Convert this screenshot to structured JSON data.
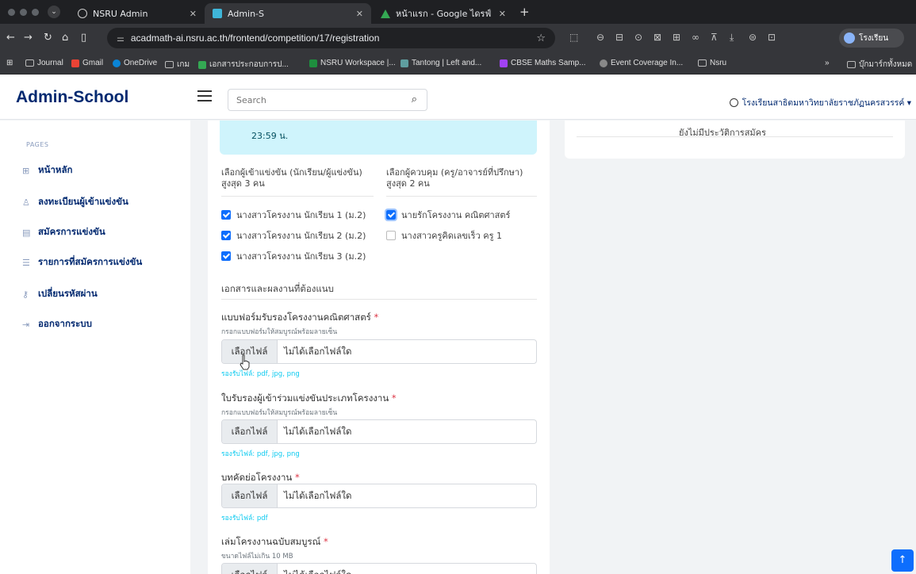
{
  "browser": {
    "tabs": [
      {
        "title": "NSRU Admin",
        "active": false
      },
      {
        "title": "Admin-S",
        "active": true
      },
      {
        "title": "หน้าแรก - Google ไดรฟ์",
        "active": false
      }
    ],
    "url": "acadmath-ai.nsru.ac.th/frontend/competition/17/registration",
    "profile_label": "โรงเรียน",
    "bookmarks": [
      "Journal",
      "Gmail",
      "OneDrive",
      "เกม",
      "เอกสารประกอบการป...",
      "NSRU Workspace |...",
      "Tantong | Left and...",
      "CBSE Maths Samp...",
      "Event Coverage In...",
      "Nsru"
    ],
    "bookmarks_overflow": "»",
    "all_bookmarks": "บุ๊กมาร์กทั้งหมด"
  },
  "header": {
    "logo": "Admin-School",
    "search_placeholder": "Search",
    "school_name": "โรงเรียนสาธิตมหาวิทยาลัยราชภัฏนครสวรรค์ ▾"
  },
  "sidebar": {
    "heading": "PAGES",
    "items": [
      {
        "label": "หน้าหลัก",
        "icon": "grid-icon"
      },
      {
        "label": "ลงทะเบียนผู้เข้าแข่งขัน",
        "icon": "person-icon"
      },
      {
        "label": "สมัครการแข่งขัน",
        "icon": "file-icon"
      },
      {
        "label": "รายการที่สมัครการแข่งขัน",
        "icon": "list-icon"
      },
      {
        "label": "เปลี่ยนรหัสผ่าน",
        "icon": "key-icon"
      },
      {
        "label": "ออกจากระบบ",
        "icon": "logout-icon"
      }
    ]
  },
  "main": {
    "info_text": "23:59 น.",
    "students_heading": "เลือกผู้เข้าแข่งขัน (นักเรียน/ผู้แข่งขัน) สูงสุด 3 คน",
    "teachers_heading": "เลือกผู้ควบคุม (ครู/อาจารย์ที่ปรึกษา) สูงสุด 2 คน",
    "students": [
      {
        "name": "นางสาวโครงงาน นักเรียน 1 (ม.2)",
        "checked": true
      },
      {
        "name": "นางสาวโครงงาน นักเรียน 2 (ม.2)",
        "checked": true
      },
      {
        "name": "นางสาวโครงงาน นักเรียน 3 (ม.2)",
        "checked": true
      }
    ],
    "teachers": [
      {
        "name": "นายรักโครงงาน คณิตศาสตร์",
        "checked": true
      },
      {
        "name": "นางสาวครูคิดเลขเร็ว ครู 1",
        "checked": false
      }
    ],
    "documents_title": "เอกสารและผลงานที่ต้องแนบ",
    "choose_file": "เลือกไฟล์",
    "no_file": "ไม่ได้เลือกไฟล์ใด",
    "required_mark": "*",
    "fields": [
      {
        "label": "แบบฟอร์มรับรองโครงงานคณิตศาสตร์",
        "hint": "กรอกแบบฟอร์มให้สมบูรณ์พร้อมลายเซ็น",
        "accept": "รองรับไฟล์: pdf, jpg, png"
      },
      {
        "label": "ใบรับรองผู้เข้าร่วมแข่งขันประเภทโครงงาน",
        "hint": "กรอกแบบฟอร์มให้สมบูรณ์พร้อมลายเซ็น",
        "accept": "รองรับไฟล์: pdf, jpg, png"
      },
      {
        "label": "บทคัดย่อโครงงาน",
        "hint": "",
        "accept": "รองรับไฟล์: pdf"
      },
      {
        "label": "เล่มโครงงานฉบับสมบูรณ์",
        "hint": "ขนาดไฟล์ไม่เกิน 10 MB",
        "accept": ""
      }
    ]
  },
  "right_panel": {
    "history_text": "ยังไม่มีประวัติการสมัคร"
  },
  "back_to_top": "↑"
}
